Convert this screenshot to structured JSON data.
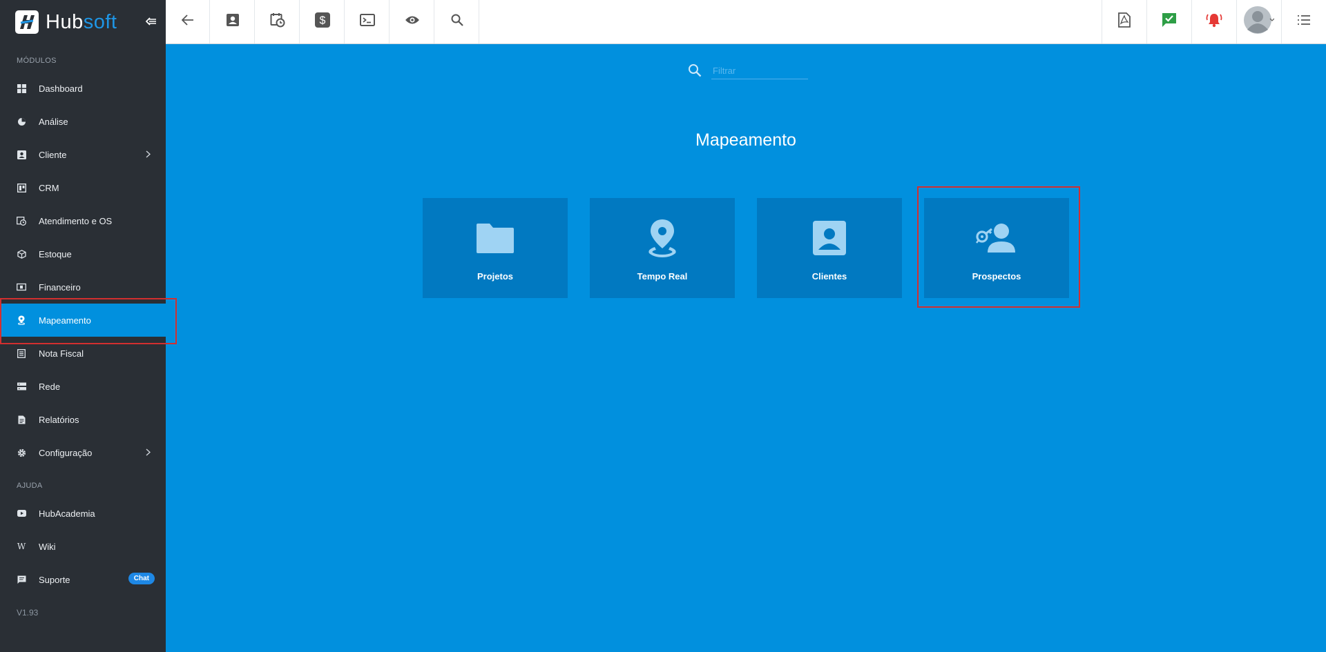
{
  "app": {
    "logo_prefix": "Hub",
    "logo_suffix": "soft",
    "version": "V1.93"
  },
  "sidebar": {
    "section_modules": "MÓDULOS",
    "section_help": "AJUDA",
    "items": [
      {
        "label": "Dashboard",
        "icon": "dashboard-icon"
      },
      {
        "label": "Análise",
        "icon": "pie-chart-icon"
      },
      {
        "label": "Cliente",
        "icon": "contact-card-icon",
        "has_submenu": true
      },
      {
        "label": "CRM",
        "icon": "crm-board-icon"
      },
      {
        "label": "Atendimento e OS",
        "icon": "calendar-clock-icon"
      },
      {
        "label": "Estoque",
        "icon": "box-icon"
      },
      {
        "label": "Financeiro",
        "icon": "money-icon"
      },
      {
        "label": "Mapeamento",
        "icon": "map-pin-icon",
        "active": true
      },
      {
        "label": "Nota Fiscal",
        "icon": "receipt-icon"
      },
      {
        "label": "Rede",
        "icon": "server-icon"
      },
      {
        "label": "Relatórios",
        "icon": "report-icon"
      },
      {
        "label": "Configuração",
        "icon": "gear-icon",
        "has_submenu": true
      }
    ],
    "help_items": [
      {
        "label": "HubAcademia",
        "icon": "youtube-icon"
      },
      {
        "label": "Wiki",
        "icon": "wikipedia-icon"
      },
      {
        "label": "Suporte",
        "icon": "chat-icon",
        "badge": "Chat"
      }
    ]
  },
  "topbar": {
    "left_buttons": [
      "back-arrow-icon",
      "contact-card-icon",
      "calendar-clock-icon",
      "dollar-icon",
      "terminal-icon",
      "eye-icon",
      "search-icon"
    ],
    "right_buttons": [
      "pdf-icon",
      "checked-message-icon",
      "alarm-bell-icon",
      "user-avatar",
      "list-menu-icon"
    ]
  },
  "main": {
    "filter_placeholder": "Filtrar",
    "title": "Mapeamento",
    "cards": [
      {
        "label": "Projetos",
        "icon": "folder-icon"
      },
      {
        "label": "Tempo Real",
        "icon": "map-pin-icon"
      },
      {
        "label": "Clientes",
        "icon": "contact-card-icon"
      },
      {
        "label": "Prospectos",
        "icon": "person-key-icon",
        "highlighted": true
      }
    ]
  },
  "colors": {
    "accent": "#0190de",
    "sidebar_bg": "#2a2f35",
    "card_bg": "#0179c1",
    "highlight": "#d32f2f",
    "icon_card": "#9fd3f3"
  }
}
